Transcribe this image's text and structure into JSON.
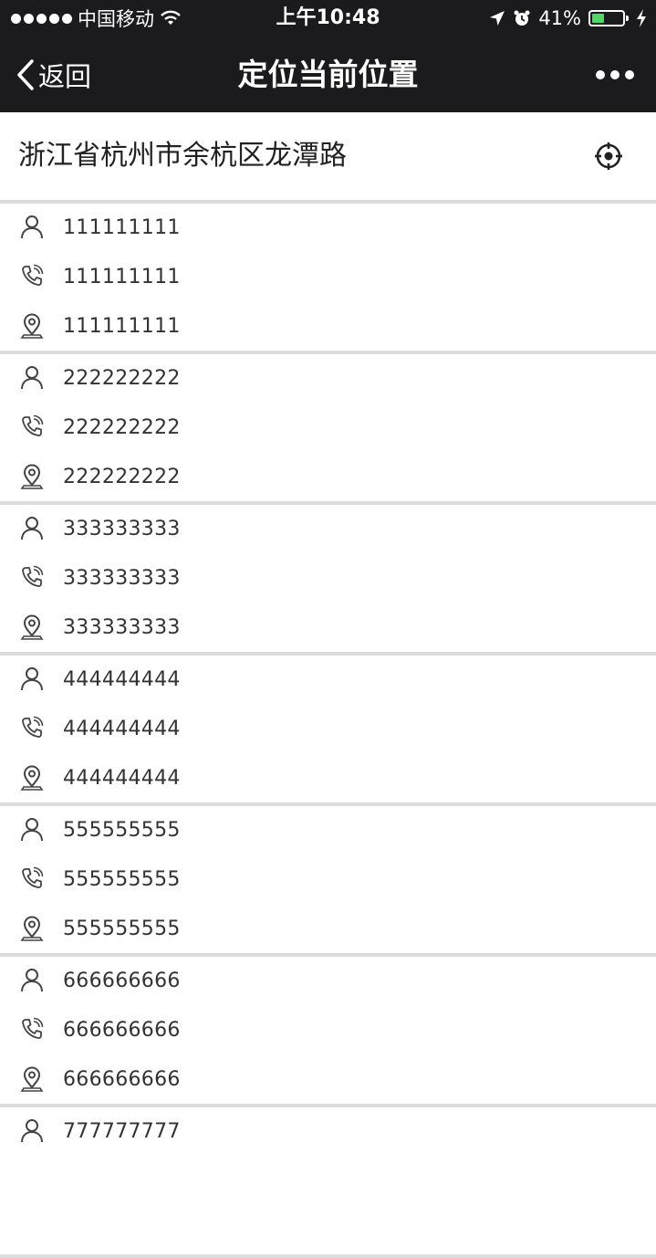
{
  "status_bar": {
    "carrier": "中国移动",
    "time": "上午10:48",
    "battery": "41%",
    "battery_level": 0.41,
    "icons": [
      "signal-dots-icon",
      "wifi-icon",
      "location-arrow-icon",
      "alarm-icon",
      "battery-icon",
      "charging-bolt-icon"
    ]
  },
  "nav": {
    "back_label": "返回",
    "title": "定位当前位置"
  },
  "address": {
    "text": "浙江省杭州市余杭区龙潭路"
  },
  "contacts": [
    {
      "name": "111111111",
      "phone": "111111111",
      "address": "111111111"
    },
    {
      "name": "222222222",
      "phone": "222222222",
      "address": "222222222"
    },
    {
      "name": "333333333",
      "phone": "333333333",
      "address": "333333333"
    },
    {
      "name": "444444444",
      "phone": "444444444",
      "address": "444444444"
    },
    {
      "name": "555555555",
      "phone": "555555555",
      "address": "555555555"
    },
    {
      "name": "666666666",
      "phone": "666666666",
      "address": "666666666"
    },
    {
      "name": "777777777",
      "phone": "",
      "address": ""
    }
  ],
  "colors": {
    "bar_background": "#1b1b1d",
    "divider": "#dcdcdc",
    "battery_fill": "#4cd964"
  }
}
